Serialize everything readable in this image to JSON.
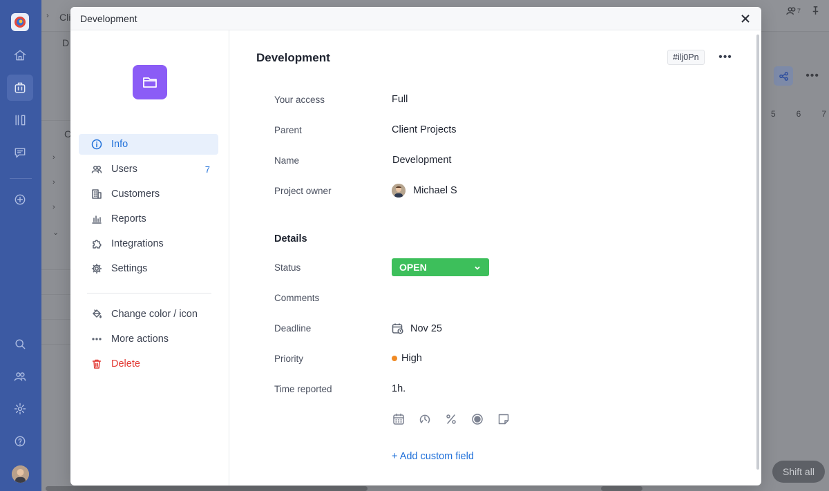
{
  "background": {
    "breadcrumb_fragment": "Cli",
    "row_fragment": "D",
    "column_fragment": "C",
    "timeline_days": [
      "5",
      "6",
      "7"
    ],
    "users_count": "7",
    "shift_all_label": "Shift all"
  },
  "modal": {
    "window_title": "Development",
    "title": "Development",
    "id_tag": "#ilj0Pn",
    "folder_color": "#8b5cf6"
  },
  "sidebar": {
    "items": [
      {
        "label": "Info",
        "icon": "info-icon",
        "active": true
      },
      {
        "label": "Users",
        "icon": "users-icon",
        "count": "7"
      },
      {
        "label": "Customers",
        "icon": "building-icon"
      },
      {
        "label": "Reports",
        "icon": "chart-icon"
      },
      {
        "label": "Integrations",
        "icon": "puzzle-icon"
      },
      {
        "label": "Settings",
        "icon": "gear-icon"
      }
    ],
    "actions": [
      {
        "label": "Change color / icon",
        "icon": "paint-bucket-icon"
      },
      {
        "label": "More actions",
        "icon": "more-dots-icon"
      },
      {
        "label": "Delete",
        "icon": "trash-icon"
      }
    ]
  },
  "info": {
    "your_access": {
      "label": "Your access",
      "value": "Full"
    },
    "parent": {
      "label": "Parent",
      "value": "Client Projects"
    },
    "name": {
      "label": "Name",
      "value": "Development"
    },
    "project_owner": {
      "label": "Project owner",
      "value": "Michael S"
    }
  },
  "details": {
    "heading": "Details",
    "status": {
      "label": "Status",
      "value": "OPEN",
      "color": "#3dbf5b"
    },
    "comments": {
      "label": "Comments"
    },
    "deadline": {
      "label": "Deadline",
      "value": "Nov 25"
    },
    "priority": {
      "label": "Priority",
      "value": "High",
      "color": "#f08a24"
    },
    "time_reported": {
      "label": "Time reported",
      "value": "1h."
    },
    "custom_field_icons": [
      "calendar-grid-icon",
      "time-dial-icon",
      "percent-icon",
      "radio-icon",
      "note-icon"
    ],
    "add_custom_field": "+ Add custom field"
  }
}
